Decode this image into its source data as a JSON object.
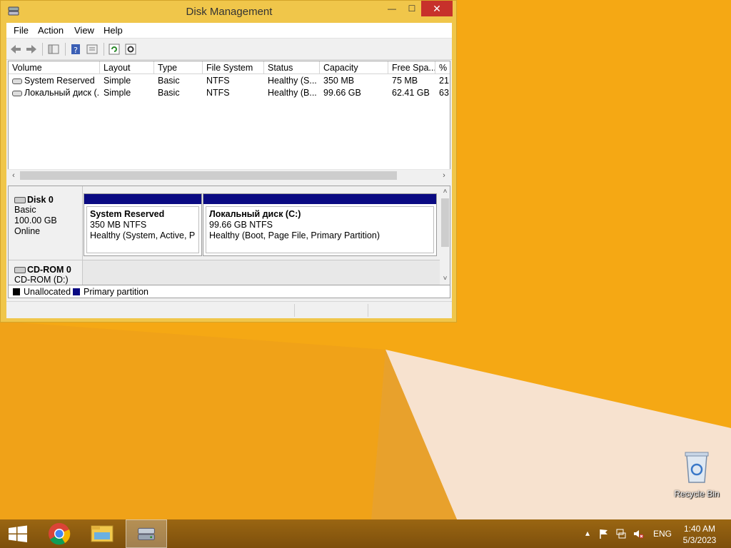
{
  "window": {
    "title": "Disk Management",
    "controls": {
      "minimize": "—",
      "maximize": "☐",
      "close": "✕"
    }
  },
  "menu": [
    "File",
    "Action",
    "View",
    "Help"
  ],
  "volume_list": {
    "columns": [
      "Volume",
      "Layout",
      "Type",
      "File System",
      "Status",
      "Capacity",
      "Free Spa...",
      "% F"
    ],
    "rows": [
      [
        "System Reserved",
        "Simple",
        "Basic",
        "NTFS",
        "Healthy (S...",
        "350 MB",
        "75 MB",
        "21"
      ],
      [
        "Локальный диск (...",
        "Simple",
        "Basic",
        "NTFS",
        "Healthy (B...",
        "99.66 GB",
        "62.41 GB",
        "63"
      ]
    ]
  },
  "disks": [
    {
      "name": "Disk 0",
      "lines": [
        "Basic",
        "100.00 GB",
        "Online"
      ],
      "partitions": [
        {
          "name": "System Reserved",
          "size": "350 MB NTFS",
          "status": "Healthy (System, Active, Prin"
        },
        {
          "name": "Локальный диск  (C:)",
          "size": "99.66 GB NTFS",
          "status": "Healthy (Boot, Page File, Primary Partition)"
        }
      ]
    },
    {
      "name": "CD-ROM 0",
      "lines": [
        "CD-ROM (D:)"
      ]
    }
  ],
  "legend": [
    {
      "label": "Unallocated",
      "color": "#000000"
    },
    {
      "label": "Primary partition",
      "color": "#0a0a82"
    }
  ],
  "desktop": {
    "recycle_bin_label": "Recycle Bin",
    "wallpaper_color": "#f5a814"
  },
  "taskbar": {
    "language": "ENG",
    "time": "1:40 AM",
    "date": "5/3/2023"
  }
}
